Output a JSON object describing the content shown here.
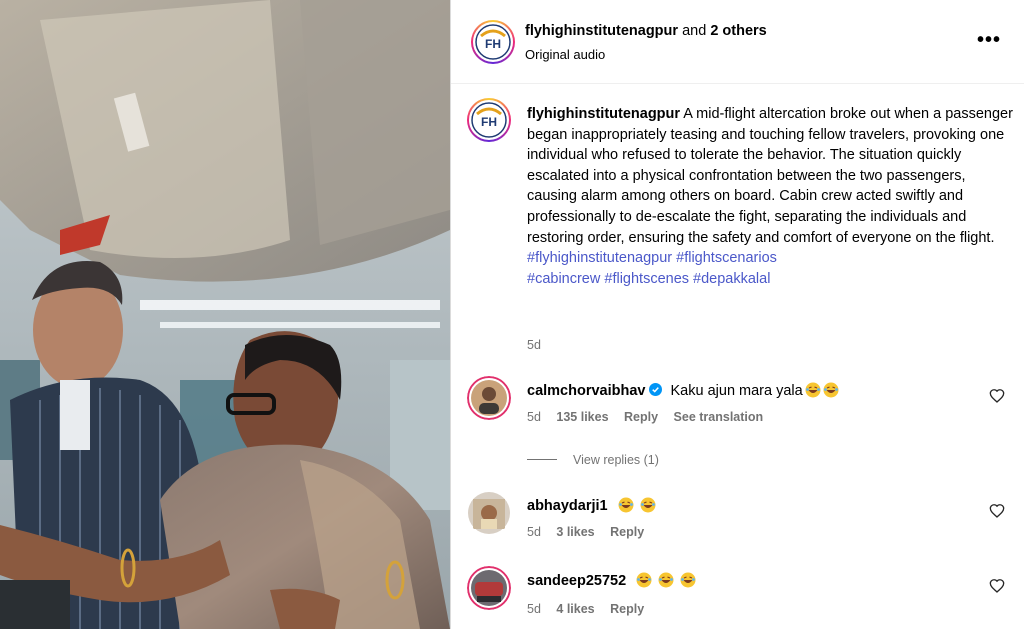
{
  "header": {
    "username": "flyhighinstitutenagpur",
    "joiner": "and",
    "others": "2 others",
    "audio": "Original audio",
    "more_icon": "more-horizontal-icon",
    "logo_text": "FH"
  },
  "caption": {
    "username": "flyhighinstitutenagpur",
    "text": "A mid-flight altercation broke out when a passenger began inappropriately teasing and touching fellow travelers, provoking one individual who refused to tolerate the behavior. The situation quickly escalated into a physical confrontation between the two passengers, causing alarm among others on board. Cabin crew acted swiftly and professionally to de-escalate the fight, separating the individuals and restoring order, ensuring the safety and comfort of everyone on the flight.",
    "hashtags": [
      "#flyhighinstitutenagpur",
      "#flightscenarios",
      "#cabincrew",
      "#flightscenes",
      "#depakkalal"
    ],
    "time": "5d"
  },
  "comments": [
    {
      "username": "calmchorvaibhav",
      "verified": true,
      "text": "Kaku ajun mara yala",
      "emoji_count": 2,
      "time": "5d",
      "likes": "135 likes",
      "reply": "Reply",
      "translation": "See translation"
    },
    {
      "username": "abhaydarji1",
      "verified": false,
      "text": "",
      "emoji_count": 2,
      "time": "5d",
      "likes": "3 likes",
      "reply": "Reply"
    },
    {
      "username": "sandeep25752",
      "verified": false,
      "text": "",
      "emoji_count": 3,
      "time": "5d",
      "likes": "4 likes",
      "reply": "Reply"
    }
  ],
  "view_replies": "View replies (1)",
  "colors": {
    "hashtag": "#4b58c9",
    "meta": "#737373",
    "verified": "#0095f6"
  }
}
